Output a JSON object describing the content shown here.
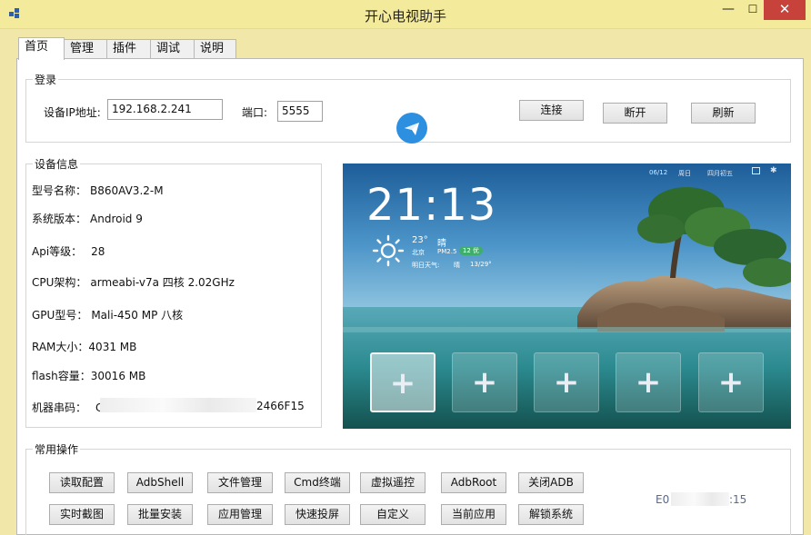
{
  "window": {
    "title": "开心电视助手",
    "minimize_glyph": "—",
    "maximize_glyph": "☐",
    "close_glyph": "✕"
  },
  "tabs": [
    {
      "label": "首页",
      "active": true
    },
    {
      "label": "管理"
    },
    {
      "label": "插件"
    },
    {
      "label": "调试"
    },
    {
      "label": "说明"
    }
  ],
  "login": {
    "group_title": "登录",
    "ip_label": "设备IP地址:",
    "ip_value": "192.168.2.241",
    "port_label": "端口:",
    "port_value": "5555",
    "connect_label": "连接",
    "disconnect_label": "断开",
    "refresh_label": "刷新",
    "send_icon": "paper-plane-icon"
  },
  "device_info": {
    "group_title": "设备信息",
    "rows": [
      {
        "label": "型号名称：",
        "value": "B860AV3.2-M"
      },
      {
        "label": "系统版本：",
        "value": "Android 9"
      },
      {
        "label": "Api等级：",
        "value": "28"
      },
      {
        "label": "CPU架构：",
        "value": "armeabi-v7a 四核 2.02GHz"
      },
      {
        "label": "GPU型号：",
        "value": "Mali-450 MP 八核"
      },
      {
        "label": "RAM大小：",
        "value": "4031 MB"
      },
      {
        "label": "flash容量：",
        "value": "30016 MB"
      },
      {
        "label": "机器串码：",
        "value_prefix": "C",
        "value_suffix": "2466F15"
      }
    ]
  },
  "screen_preview": {
    "date": "06/12",
    "weekday": "周日",
    "lunar": "四月初五",
    "time": "21:13",
    "temperature": "23°",
    "weather": "晴",
    "city": "北京",
    "pm_label": "PM2.5",
    "aqi": "12 优",
    "tomorrow_label": "明日天气:",
    "tomorrow_weather": "晴",
    "tomorrow_range": "13/29°",
    "tile_glyph": "+",
    "weather_icon": "sun-icon"
  },
  "common_ops": {
    "group_title": "常用操作",
    "row1": [
      "读取配置",
      "AdbShell",
      "文件管理",
      "Cmd终端",
      "虚拟遥控",
      "AdbRoot",
      "关闭ADB"
    ],
    "row2": [
      "实时截图",
      "批量安装",
      "应用管理",
      "快速投屏",
      "自定义",
      "当前应用",
      "解锁系统"
    ],
    "serial_prefix": "E0",
    "serial_suffix": ":15"
  }
}
